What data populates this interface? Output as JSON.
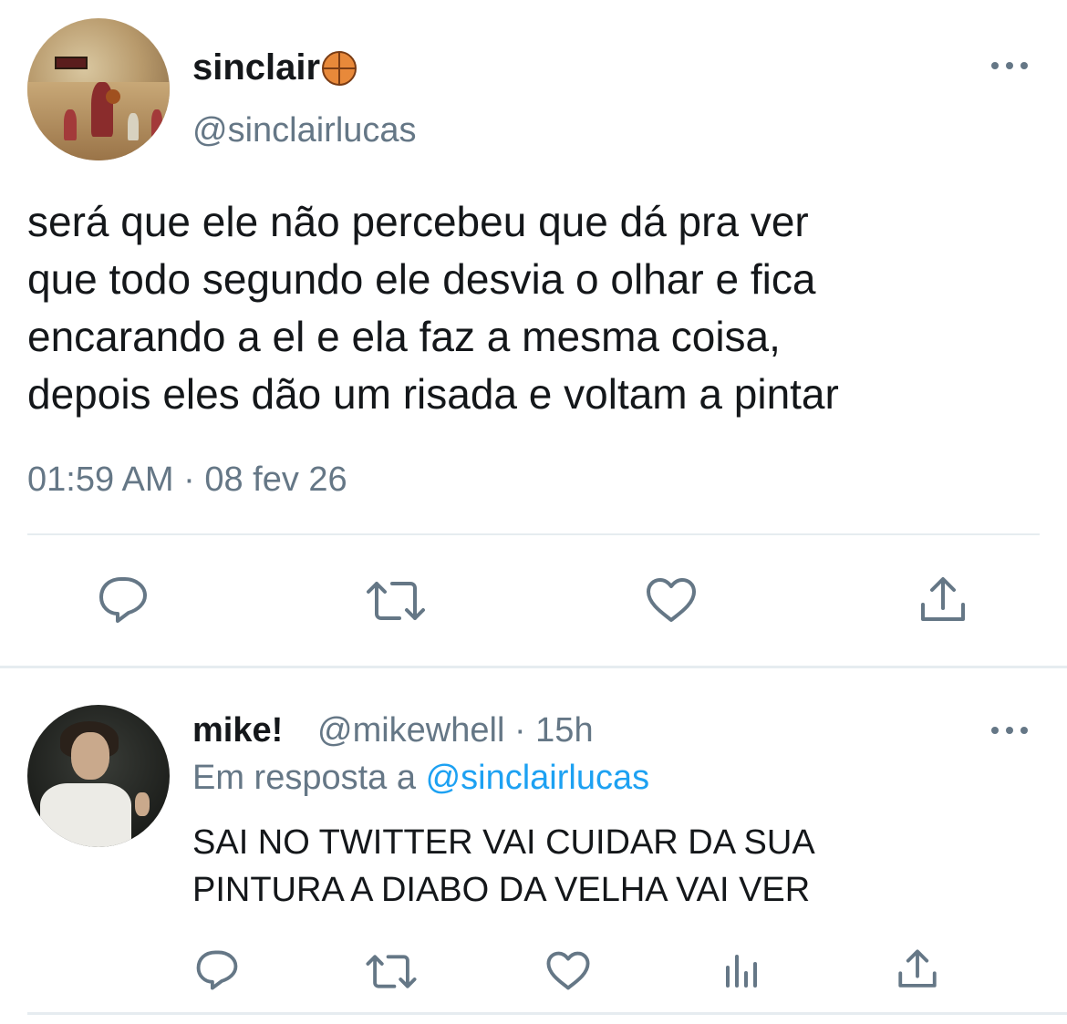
{
  "main_tweet": {
    "display_name": "sinclair",
    "name_emoji": "basketball-icon",
    "handle": "@sinclairlucas",
    "text": "será que ele não percebeu que dá pra ver\nque todo segundo ele desvia o olhar e fica\nencarando a el e ela faz a mesma coisa,\ndepois eles dão um risada e voltam a pintar",
    "timestamp": "01:59 AM · 08 fev 26",
    "actions": [
      "reply-icon",
      "retweet-icon",
      "like-icon",
      "share-icon"
    ]
  },
  "reply_tweet": {
    "display_name": "mike!",
    "handle_time": "@mikewhell · 15h",
    "reply_to_prefix": "Em resposta a ",
    "reply_to_mention": "@sinclairlucas",
    "text": "SAI NO TWITTER VAI CUIDAR DA SUA\nPINTURA A DIABO DA VELHA VAI VER",
    "actions": [
      "reply-icon",
      "retweet-icon",
      "like-icon",
      "analytics-icon",
      "share-icon"
    ]
  },
  "colors": {
    "text": "#14171a",
    "secondary": "#657786",
    "mention": "#1da1f2",
    "divider": "#e6ecf0"
  }
}
